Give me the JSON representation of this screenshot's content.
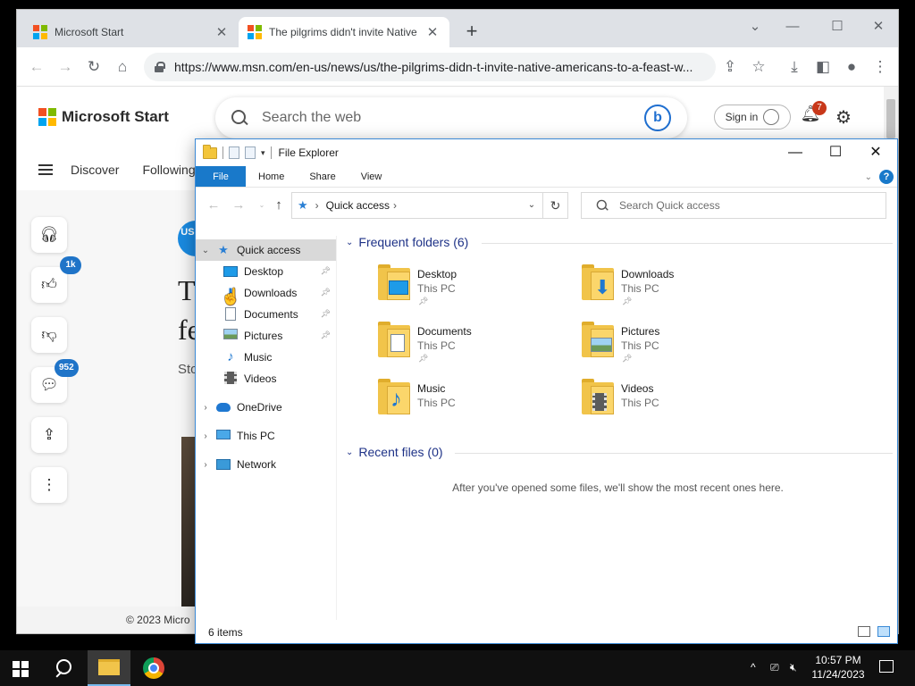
{
  "browser": {
    "tabs": [
      {
        "title": "Microsoft Start"
      },
      {
        "title": "The pilgrims didn't invite Native"
      }
    ],
    "url": "https://www.msn.com/en-us/news/us/the-pilgrims-didn-t-invite-native-americans-to-a-feast-w..."
  },
  "msn": {
    "brand": "Microsoft Start",
    "search_placeholder": "Search the web",
    "signin_label": "Sign in",
    "notification_count": "7",
    "nav": [
      "Discover",
      "Following"
    ],
    "rail": {
      "like_count": "1k",
      "comment_count": "952"
    },
    "article": {
      "publisher_badge": "US TO",
      "title_line1": "T",
      "title_line2": "fe",
      "subtitle": "Sto"
    },
    "footer": "© 2023 Micro"
  },
  "explorer": {
    "title": "File Explorer",
    "ribbon_tabs": [
      "File",
      "Home",
      "Share",
      "View"
    ],
    "address": "Quick access",
    "search_placeholder": "Search Quick access",
    "nav": {
      "quick_access": "Quick access",
      "pinned": [
        "Desktop",
        "Downloads",
        "Documents",
        "Pictures"
      ],
      "other": [
        "Music",
        "Videos"
      ],
      "onedrive": "OneDrive",
      "this_pc": "This PC",
      "network": "Network"
    },
    "frequent_header": "Frequent folders (6)",
    "folders": [
      {
        "name": "Desktop",
        "location": "This PC",
        "pinned": true
      },
      {
        "name": "Downloads",
        "location": "This PC",
        "pinned": true
      },
      {
        "name": "Documents",
        "location": "This PC",
        "pinned": true
      },
      {
        "name": "Pictures",
        "location": "This PC",
        "pinned": true
      },
      {
        "name": "Music",
        "location": "This PC",
        "pinned": false
      },
      {
        "name": "Videos",
        "location": "This PC",
        "pinned": false
      }
    ],
    "recent_header": "Recent files (0)",
    "recent_empty": "After you've opened some files, we'll show the most recent ones here.",
    "status": "6 items"
  },
  "taskbar": {
    "time": "10:57 PM",
    "date": "11/24/2023"
  },
  "colors": {
    "accent": "#1979ca",
    "group_header": "#1e3287",
    "folder": "#f1c44a",
    "badge_red": "#c8381a",
    "badge_blue": "#1f74c8"
  }
}
